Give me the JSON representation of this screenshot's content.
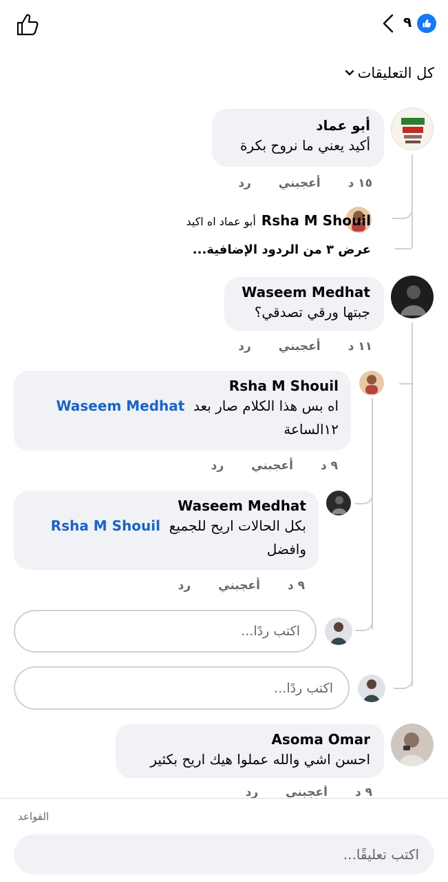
{
  "header": {
    "reaction_count": "٩",
    "sort_label": "كل التعليقات"
  },
  "comments": [
    {
      "author": "أبو عماد",
      "text": "أكيد يعني ما نروح بكرة",
      "time": "١٥ د",
      "like": "أعجبني",
      "reply": "رد",
      "reply_preview": {
        "author": "Rsha M Shouil",
        "text": "أبو عماد  اه اكيد"
      },
      "see_more": "عرض ٣ من الردود الإضافية..."
    },
    {
      "author": "Waseem Medhat",
      "text": "جبتها ورقي تصدقي؟",
      "time": "١١ د",
      "like": "أعجبني",
      "reply": "رد",
      "replies": [
        {
          "author": "Rsha M Shouil",
          "text_before": "اه بس هذا الكلام صار بعد",
          "mention": "Waseem Medhat",
          "text_after": "١٢الساعة",
          "time": "٩ د",
          "like": "أعجبني",
          "reply": "رد"
        },
        {
          "author": "Waseem Medhat",
          "text_before": "بكل الحالات اريح للجميع",
          "mention": "Rsha M Shouil",
          "text_after": "وافضل",
          "time": "٩ د",
          "like": "أعجبني",
          "reply": "رد"
        }
      ],
      "reply_placeholder_inner": "اكتب ردًا...",
      "reply_placeholder_outer": "اكتب ردًا..."
    },
    {
      "author": "Asoma Omar",
      "text": "احسن اشي والله عملوا هيك اريح بكثير",
      "time": "٩ د",
      "like": "أعجبني",
      "reply": "رد"
    }
  ],
  "footer": {
    "rules_label": "القواعد",
    "comment_placeholder": "اكتب تعليقًا..."
  },
  "colors": {
    "accent": "#1877f2",
    "mention": "#1b63c6",
    "bubble": "#f0f2f5",
    "meta": "#65676b"
  }
}
